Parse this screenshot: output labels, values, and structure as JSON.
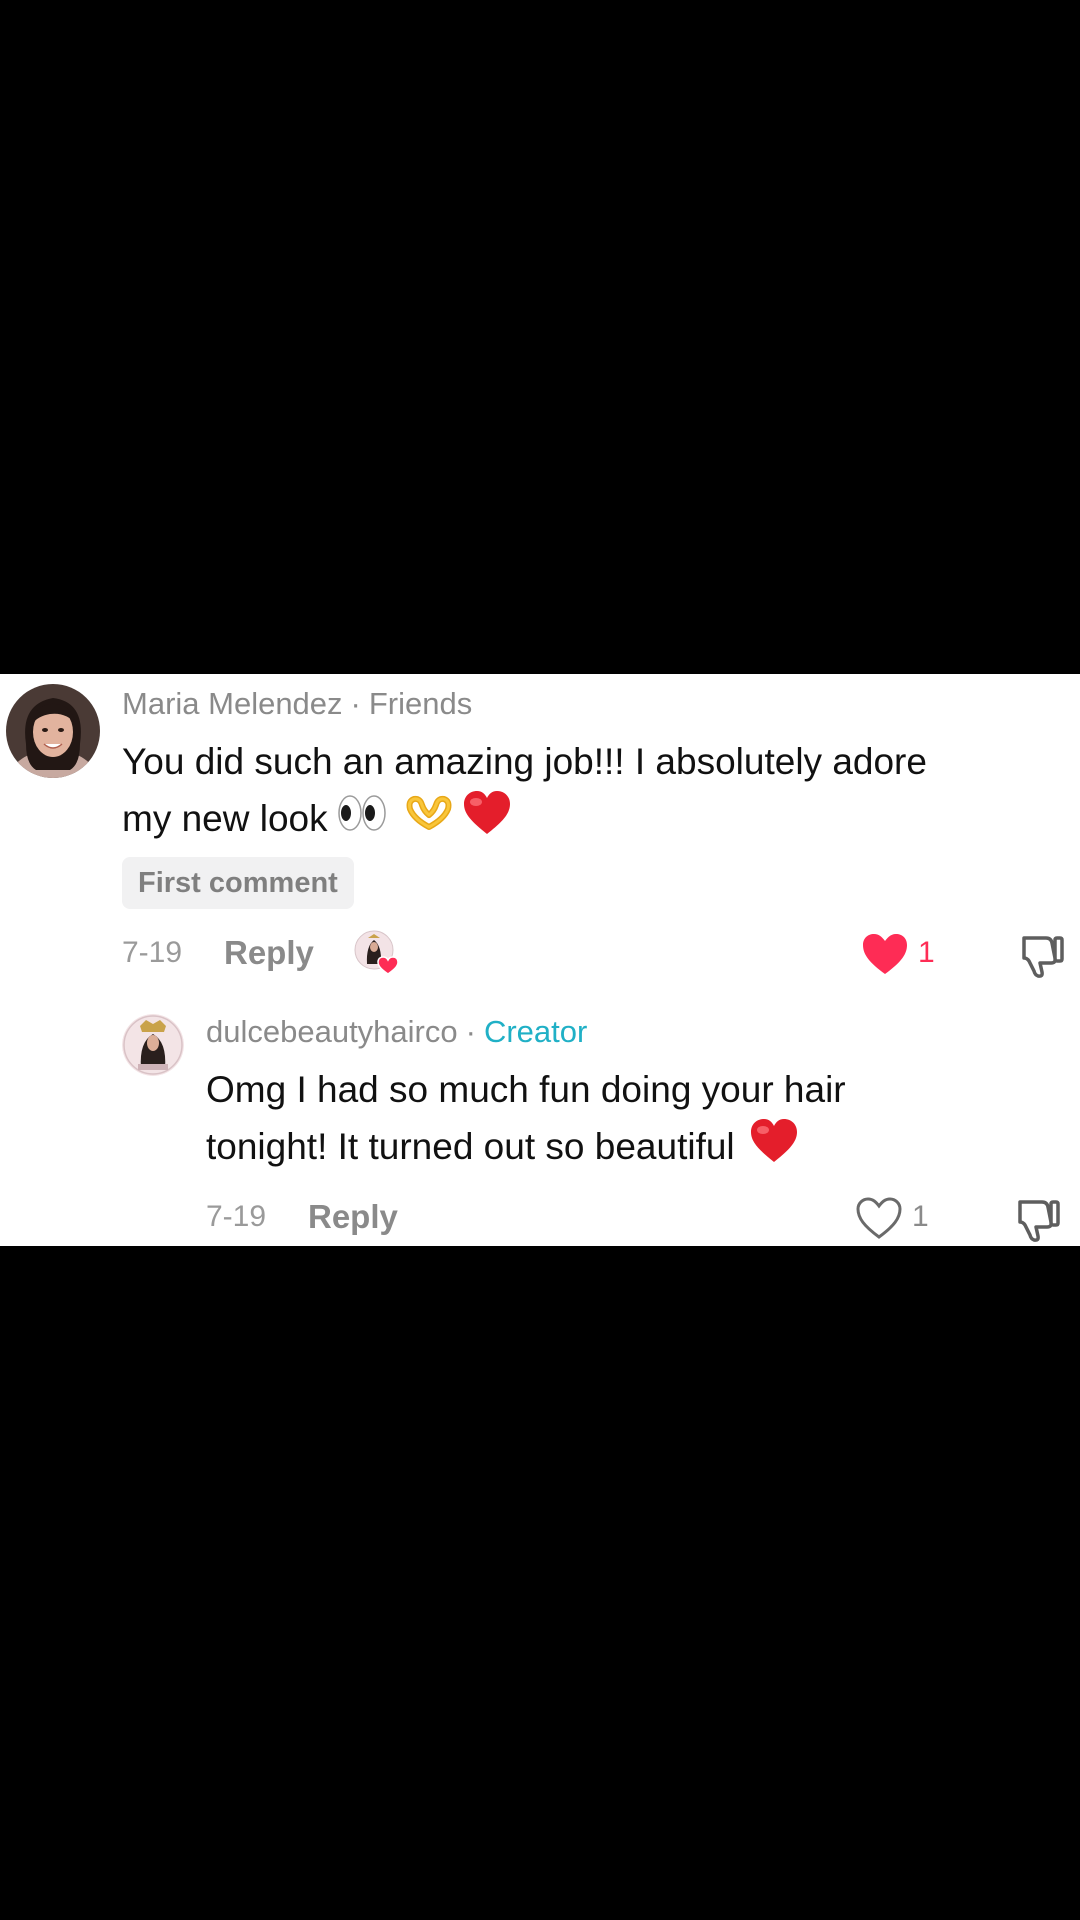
{
  "comment": {
    "author": "Maria Melendez",
    "relation": "Friends",
    "text": "You did such an amazing job!!! I absolutely adore",
    "text_line2": "my new look",
    "emojis": [
      "eyes-emoji",
      "heart-hands-emoji",
      "red-heart-emoji"
    ],
    "badge": "First comment",
    "date": "7-19",
    "reply_label": "Reply",
    "liked_by_creator": true,
    "like_count": "1",
    "liked": true
  },
  "reply": {
    "author": "dulcebeautyhairco",
    "role": "Creator",
    "text": "Omg I had so much fun doing your hair",
    "text_line2": "tonight! It turned out so beautiful",
    "emojis": [
      "red-heart-emoji"
    ],
    "date": "7-19",
    "reply_label": "Reply",
    "like_count": "1",
    "liked": false
  },
  "separator": "·",
  "colors": {
    "like_active": "#fe2c55",
    "creator": "#20b0c6",
    "meta": "#8a8a8a",
    "background": "#ffffff"
  },
  "icons": [
    "heart-filled-icon",
    "heart-outline-icon",
    "thumbs-down-icon"
  ]
}
